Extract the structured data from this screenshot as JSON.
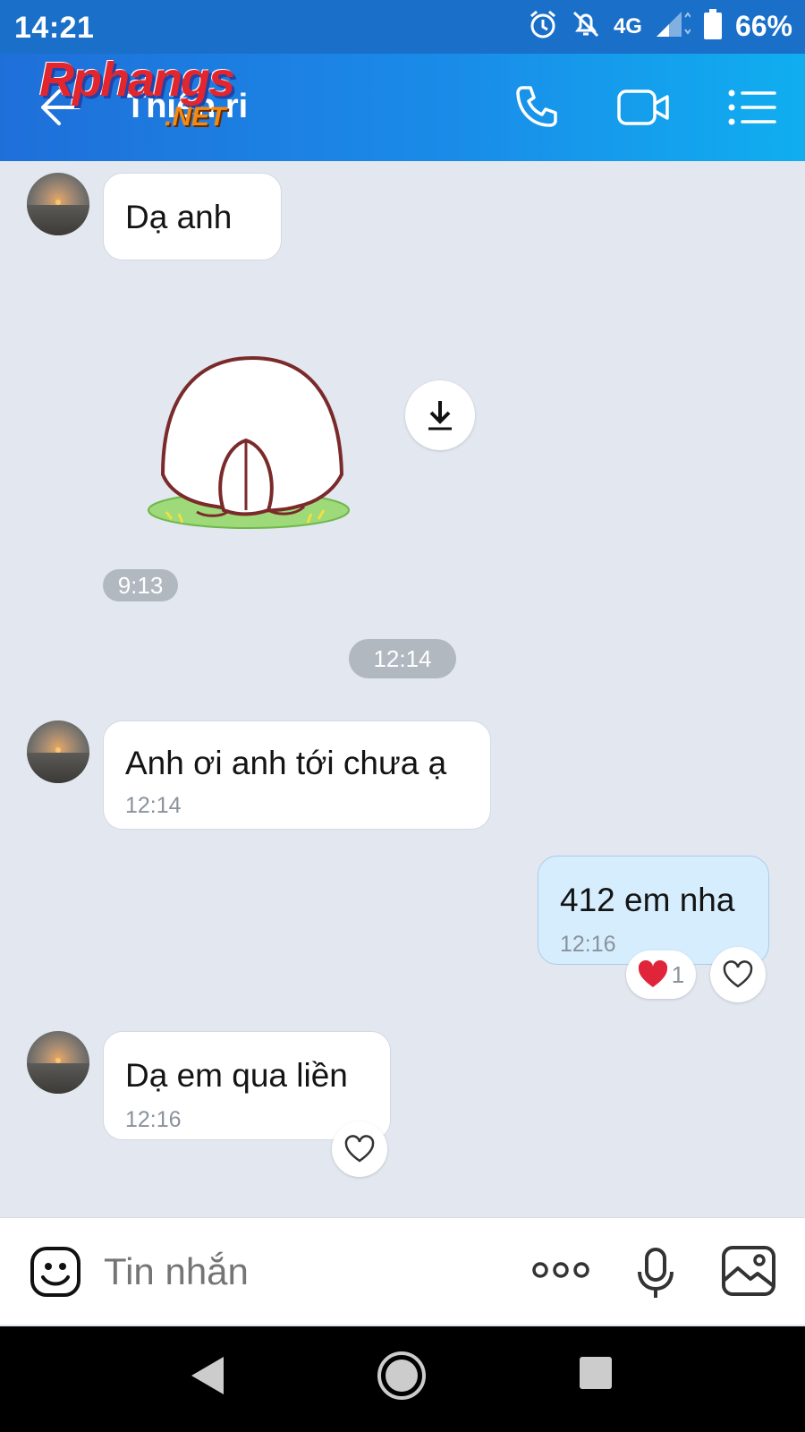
{
  "status_bar": {
    "time": "14:21",
    "network": "4G",
    "battery": "66%",
    "icons": [
      "alarm-icon",
      "mute-icon",
      "signal-icon",
      "battery-icon"
    ]
  },
  "header": {
    "title": "Thiện ri",
    "back_icon": "arrow-left-icon",
    "call_icon": "phone-icon",
    "video_icon": "video-icon",
    "menu_icon": "list-icon",
    "watermark_top": "Rphangs",
    "watermark_bottom": ".NET"
  },
  "messages": [
    {
      "sender": "contact",
      "text": "Dạ anh",
      "time": ""
    },
    {
      "sender": "contact",
      "type": "sticker",
      "sticker": "bunny-bowing-sticker",
      "time": "9:13"
    },
    {
      "separator": "12:14"
    },
    {
      "sender": "contact",
      "text": "Anh ơi anh tới chưa ạ",
      "time": "12:14"
    },
    {
      "sender": "me",
      "text": "412 em nha",
      "time": "12:16",
      "reaction_count": "1"
    },
    {
      "sender": "contact",
      "text": "Dạ em qua liền",
      "time": "12:16"
    }
  ],
  "input_bar": {
    "placeholder": "Tin nhắn",
    "icons": [
      "emoji-icon",
      "more-icon",
      "microphone-icon",
      "image-icon"
    ]
  },
  "colors": {
    "header_start": "#1f6fd9",
    "header_end": "#10aef0",
    "chat_bg": "#e2e7f0",
    "my_bubble": "#d6edfd",
    "heart": "#e0243a"
  }
}
